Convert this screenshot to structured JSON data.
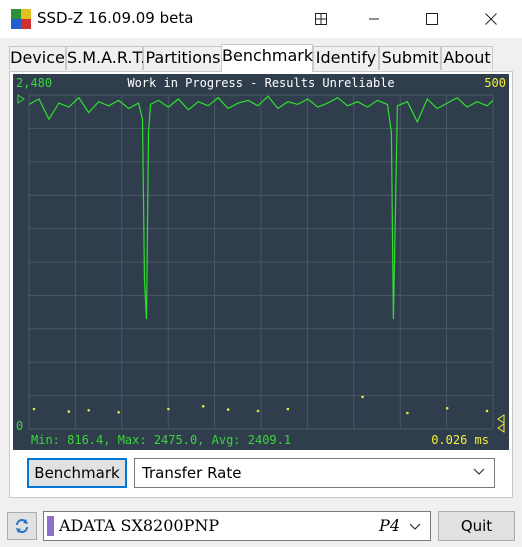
{
  "window": {
    "title": "SSD-Z 16.09.09 beta",
    "pin_icon": "pin-window-icon",
    "minimize_icon": "minimize-icon",
    "maximize_icon": "maximize-icon",
    "close_icon": "close-icon"
  },
  "tabs": [
    {
      "label": "Device"
    },
    {
      "label": "S.M.A.R.T."
    },
    {
      "label": "Partitions"
    },
    {
      "label": "Benchmark",
      "active": true
    },
    {
      "label": "Identify"
    },
    {
      "label": "Submit"
    },
    {
      "label": "About"
    }
  ],
  "benchmark": {
    "banner": "Work in Progress - Results Unreliable",
    "left_axis_max": "2,480",
    "left_axis_min": "0",
    "right_axis_max": "500",
    "stats": "Min: 816.4, Max: 2475.0, Avg: 2409.1",
    "latency": "0.026 ms",
    "button_label": "Benchmark",
    "mode_selected": "Transfer Rate"
  },
  "drive": {
    "name": "ADATA SX8200PNP",
    "interface": "P4",
    "swatch_color": "#8e6fc7"
  },
  "quit_label": "Quit",
  "colors": {
    "chart_bg": "#2f3d4d",
    "grid": "#4a5868",
    "transfer_line": "#2fe02f",
    "latency_dots": "#e8e83a",
    "label_green": "#39d639",
    "label_yellow": "#f0f03c",
    "accent_border": "#0078d7"
  },
  "chart_data": {
    "type": "line",
    "title": "Work in Progress - Results Unreliable",
    "y_left_range": [
      0,
      2480
    ],
    "y_right_range": [
      0,
      500
    ],
    "series": [
      {
        "axis": "left",
        "x": [
          0,
          10,
          20,
          30,
          40,
          50,
          60,
          70,
          80,
          90,
          100,
          110,
          114,
          116,
          118,
          120,
          122,
          130,
          140,
          150,
          160,
          170,
          180,
          190,
          200,
          210,
          220,
          230,
          240,
          250,
          260,
          270,
          280,
          290,
          300,
          310,
          320,
          330,
          340,
          350,
          360,
          364,
          366,
          368,
          370,
          380,
          390,
          400,
          410,
          420,
          430,
          440,
          450,
          460,
          466
        ],
        "y": [
          2410,
          2450,
          2300,
          2420,
          2390,
          2460,
          2350,
          2430,
          2400,
          2440,
          2380,
          2420,
          2300,
          1100,
          816,
          2200,
          2410,
          2440,
          2390,
          2450,
          2370,
          2430,
          2400,
          2460,
          2380,
          2420,
          2440,
          2400,
          2470,
          2380,
          2430,
          2410,
          2450,
          2390,
          2420,
          2460,
          2400,
          2430,
          2390,
          2440,
          2410,
          2200,
          816,
          1600,
          2400,
          2430,
          2280,
          2450,
          2380,
          2420,
          2460,
          2390,
          2430,
          2400,
          2440
        ]
      },
      {
        "axis": "right",
        "x": [
          5,
          40,
          60,
          90,
          140,
          175,
          200,
          230,
          260,
          335,
          380,
          420,
          460
        ],
        "y": [
          30,
          26,
          28,
          25,
          30,
          34,
          29,
          27,
          30,
          48,
          24,
          31,
          27
        ]
      }
    ]
  }
}
